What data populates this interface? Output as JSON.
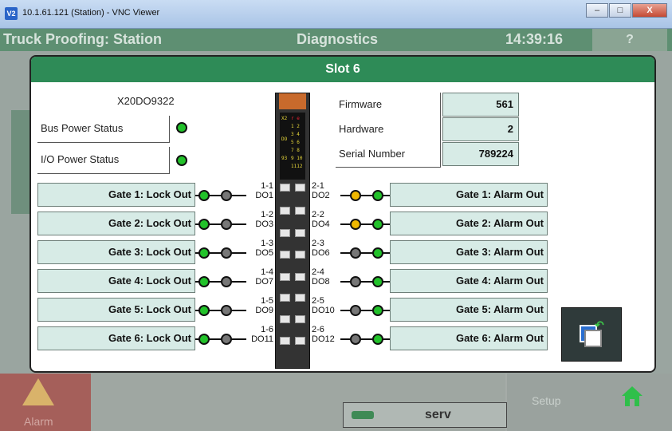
{
  "window": {
    "title": "10.1.61.121 (Station) - VNC Viewer",
    "min": "–",
    "max": "□",
    "close": "X"
  },
  "header": {
    "app_name": "Truck Proofing: Station",
    "screen_name": "Diagnostics",
    "time": "14:39:16",
    "help": "?"
  },
  "dialog": {
    "title": "Slot 6",
    "module_name": "X20DO9322",
    "bus_power_label": "Bus Power Status",
    "io_power_label": "I/O Power Status",
    "firmware_label": "Firmware",
    "firmware_value": "561",
    "hardware_label": "Hardware",
    "hardware_value": "2",
    "serial_label": "Serial Number",
    "serial_value": "789224",
    "left_outputs": [
      {
        "label": "Gate 1: Lock Out",
        "pin": "1-1",
        "channel": "DO1"
      },
      {
        "label": "Gate 2: Lock Out",
        "pin": "1-2",
        "channel": "DO3"
      },
      {
        "label": "Gate 3: Lock Out",
        "pin": "1-3",
        "channel": "DO5"
      },
      {
        "label": "Gate 4: Lock Out",
        "pin": "1-4",
        "channel": "DO7"
      },
      {
        "label": "Gate 5: Lock Out",
        "pin": "1-5",
        "channel": "DO9"
      },
      {
        "label": "Gate 6: Lock Out",
        "pin": "1-6",
        "channel": "DO11"
      }
    ],
    "right_outputs": [
      {
        "label": "Gate 1: Alarm Out",
        "pin": "2-1",
        "channel": "DO2"
      },
      {
        "label": "Gate 2: Alarm Out",
        "pin": "2-2",
        "channel": "DO4"
      },
      {
        "label": "Gate 3: Alarm Out",
        "pin": "2-3",
        "channel": "DO6"
      },
      {
        "label": "Gate 4: Alarm Out",
        "pin": "2-4",
        "channel": "DO8"
      },
      {
        "label": "Gate 5: Alarm Out",
        "pin": "2-5",
        "channel": "DO10"
      },
      {
        "label": "Gate 6: Alarm Out",
        "pin": "2-6",
        "channel": "DO12"
      }
    ]
  },
  "bottom": {
    "alarm_label": "Alarm",
    "status_text": "serv",
    "setup_label": "Setup"
  },
  "colors": {
    "header": "#5e8f72",
    "dialog_header": "#2e8b57",
    "led_green": "#22c22a",
    "led_yellow": "#f0b800",
    "led_gray": "#777777"
  }
}
